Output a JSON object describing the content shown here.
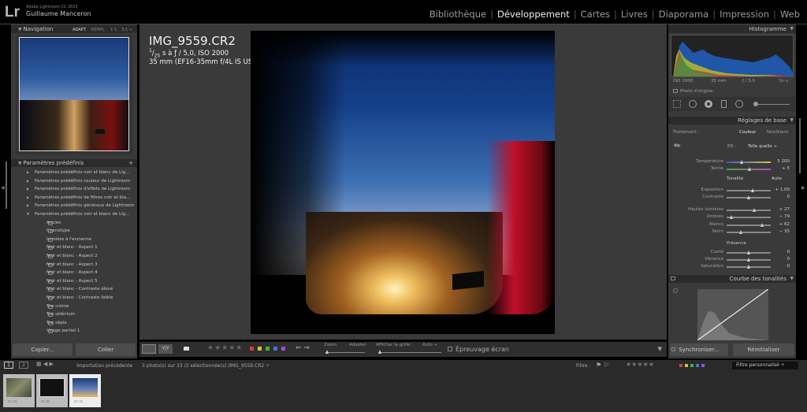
{
  "app": {
    "logo": "Lr",
    "title": "Adobe Lightroom CC 2015",
    "user": "Guillaume Manceron"
  },
  "modules": [
    "Bibliothèque",
    "Développement",
    "Cartes",
    "Livres",
    "Diaporama",
    "Impression",
    "Web"
  ],
  "active_module": "Développement",
  "navigator": {
    "title": "Navigation",
    "modes": [
      "ADAPT.",
      "REMPL.",
      "1:1",
      "3:1 ÷"
    ]
  },
  "presets": {
    "title": "Paramètres prédéfinis",
    "add": "+",
    "folders": [
      "Paramètres prédéfinis noir et blanc de Lig...",
      "Paramètres prédéfinis couleur de Lightroom",
      "Paramètres prédéfinis d'effets de Lightroom",
      "Paramètres prédéfinis de filtres noir et bla...",
      "Paramètres prédéfinis généraux de Lightroom",
      "Paramètres prédéfinis noir et blanc de Lig..."
    ],
    "items": [
      "Ancien",
      "Cyanotype",
      "Lumière à l'ancienne",
      "Noir et blanc - Aspect 1",
      "Noir et blanc - Aspect 2",
      "Noir et blanc - Aspect 3",
      "Noir et blanc - Aspect 4",
      "Noir et blanc - Aspect 5",
      "Noir et blanc - Contraste élevé",
      "Noir et blanc - Contraste faible",
      "Ton crème",
      "Ton sélénium",
      "Ton sépia",
      "Virage partiel 1"
    ]
  },
  "left_buttons": {
    "copy": "Copier...",
    "paste": "Coller"
  },
  "photo": {
    "filename": "IMG_9559.CR2",
    "exposure_num": "1",
    "exposure_den": "25",
    "exposure_rest": "s à ƒ / 5,0, ISO 2000",
    "lens": "35 mm (EF16-35mm f/4L IS USM)"
  },
  "toolbar": {
    "view_btn": "Y|Y",
    "zoom": "Zoom",
    "fit": "Adapter",
    "grid_label": "Afficher la grille :",
    "grid_value": "Auto ÷",
    "proof": "Épreuvage écran",
    "color_labels": [
      "#d63c3c",
      "#d6c23c",
      "#3cb43c",
      "#3c78d6",
      "#9a4cd6"
    ]
  },
  "histogram": {
    "title": "Histogramme",
    "iso": "ISO 2000",
    "focal": "35 mm",
    "aperture": "ƒ / 5,0",
    "shutter": "¹⁄₂₅ s",
    "original": "Photo d'origine"
  },
  "basic": {
    "title": "Réglages de base",
    "treatment": "Traitement :",
    "color": "Couleur",
    "bw": "Noir/blanc",
    "wb_label": "EB :",
    "wb_value": "Telle quelle ÷",
    "temp": {
      "label": "Température",
      "value": "5 200",
      "pos": 0.35
    },
    "tint": {
      "label": "Teinte",
      "value": "+ 5",
      "pos": 0.52
    },
    "tone_title": "Tonalité",
    "auto": "Auto",
    "exposure": {
      "label": "Exposition",
      "value": "+ 1,00",
      "pos": 0.6
    },
    "contrast": {
      "label": "Contraste",
      "value": "0",
      "pos": 0.5
    },
    "highlights": {
      "label": "Hautes lumières",
      "value": "+ 27",
      "pos": 0.64
    },
    "shadows": {
      "label": "Ombres",
      "value": "− 79",
      "pos": 0.11
    },
    "whites": {
      "label": "Blancs",
      "value": "+ 62",
      "pos": 0.81
    },
    "blacks": {
      "label": "Noirs",
      "value": "− 35",
      "pos": 0.33
    },
    "presence_title": "Présence",
    "clarity": {
      "label": "Clarté",
      "value": "0",
      "pos": 0.5
    },
    "vibrance": {
      "label": "Vibrance",
      "value": "0",
      "pos": 0.5
    },
    "saturation": {
      "label": "Saturation",
      "value": "0",
      "pos": 0.5
    }
  },
  "curve": {
    "title": "Courbe des tonalités"
  },
  "right_buttons": {
    "sync": "Synchroniser...",
    "reset": "Réinitialiser"
  },
  "filmstrip": {
    "views": [
      "1",
      "2"
    ],
    "source": "Importation précédente",
    "count": "3 photo(s) sur 33 /3 sélectionnée(s) /IMG_9559.CR2 ÷",
    "filter_label": "Filtre :",
    "filter_value": "Filtre personnalisé ÷"
  }
}
